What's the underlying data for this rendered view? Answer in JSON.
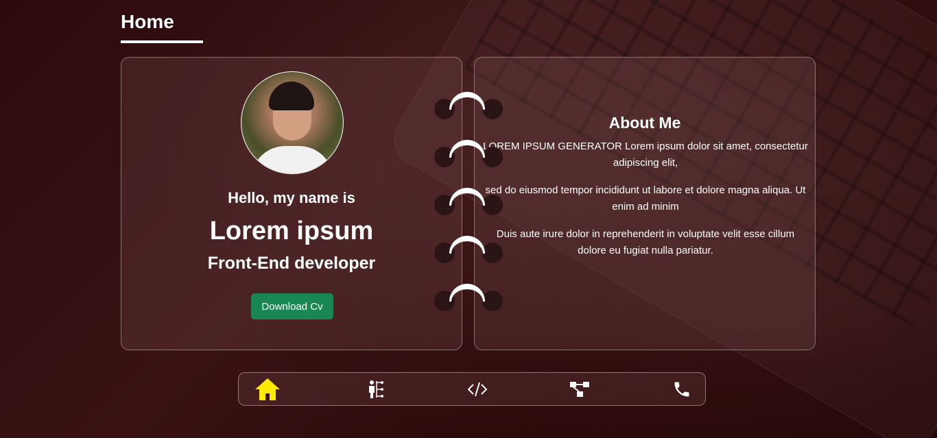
{
  "header": {
    "title": "Home"
  },
  "profile": {
    "greeting": "Hello, my name is",
    "name": "Lorem ipsum",
    "role": "Front-End developer",
    "download_label": "Download Cv"
  },
  "about": {
    "title": "About Me",
    "paragraphs": [
      "LOREM IPSUM GENERATOR Lorem ipsum dolor sit amet, consectetur adipiscing elit,",
      "sed do eiusmod tempor incididunt ut labore et dolore magna aliqua. Ut enim ad minim",
      "Duis aute irure dolor in reprehenderit in voluptate velit esse cillum dolore eu fugiat nulla pariatur."
    ]
  },
  "nav": {
    "items": [
      {
        "icon": "home-icon",
        "active": true
      },
      {
        "icon": "org-chart-icon",
        "active": false
      },
      {
        "icon": "code-icon",
        "active": false
      },
      {
        "icon": "workflow-icon",
        "active": false
      },
      {
        "icon": "phone-icon",
        "active": false
      }
    ]
  },
  "colors": {
    "accent_active_icon": "#ffeb00",
    "button_green": "#198754",
    "background_dark": "#2a0708"
  }
}
